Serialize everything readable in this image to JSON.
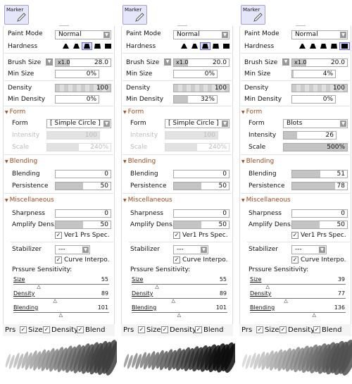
{
  "panels": [
    {
      "tool": "Marker",
      "paint_mode_label": "Paint Mode",
      "paint_mode": "Normal",
      "hardness_label": "Hardness",
      "hardness_selected": 2,
      "brush_size_label": "Brush Size",
      "brush_mult": "x1.0",
      "brush_size": "28.0",
      "min_size_label": "Min Size",
      "min_size": "0%",
      "min_size_fill": 0,
      "density_label": "Density",
      "density": "100",
      "min_density_label": "Min Density",
      "min_density": "0%",
      "min_density_fill": 0,
      "form_header": "Form",
      "form_label": "Form",
      "form": "[ Simple Circle ]",
      "form_enabled": false,
      "intensity_label": "Intensity",
      "intensity": "100",
      "intensity_fill": 1,
      "scale_label": "Scale",
      "scale": "240%",
      "scale_fill": 0.5,
      "blending_header": "Blending",
      "blending_label": "Blending",
      "blending": "0",
      "blending_fill": 0,
      "persistence_label": "Persistence",
      "persistence": "50",
      "persistence_fill": 0.5,
      "misc_header": "Miscellaneous",
      "sharpness_label": "Sharpness",
      "sharpness": "0",
      "sharpness_fill": 0,
      "amplify_label": "Amplify Dens.",
      "amplify": "50",
      "amplify_fill": 0.5,
      "ver1_label": "Ver1 Prs Spec.",
      "stabilizer_label": "Stabilizer",
      "stabilizer": "---",
      "curve_label": "Curve Interpo.",
      "pressure_label": "Prssure Sensitivity:",
      "pressure": [
        {
          "label": "Size",
          "value": "55"
        },
        {
          "label": "Density",
          "value": "89"
        },
        {
          "label": "Blending",
          "value": "101"
        }
      ],
      "prs_label": "Prs",
      "prs_size": "Size",
      "prs_density": "Density",
      "prs_blend": "Blend"
    },
    {
      "tool": "Marker",
      "paint_mode_label": "Paint Mode",
      "paint_mode": "Normal",
      "hardness_label": "Hardness",
      "hardness_selected": 2,
      "brush_size_label": "Brush Size",
      "brush_mult": "x1.0",
      "brush_size": "20.0",
      "min_size_label": "Min Size",
      "min_size": "0%",
      "min_size_fill": 0,
      "density_label": "Density",
      "density": "100",
      "min_density_label": "Min Density",
      "min_density": "32%",
      "min_density_fill": 0.32,
      "form_header": "Form",
      "form_label": "Form",
      "form": "[ Simple Circle ]",
      "form_enabled": false,
      "intensity_label": "Intensity",
      "intensity": "100",
      "intensity_fill": 1,
      "scale_label": "Scale",
      "scale": "240%",
      "scale_fill": 0.5,
      "blending_header": "Blending",
      "blending_label": "Blending",
      "blending": "0",
      "blending_fill": 0,
      "persistence_label": "Persistence",
      "persistence": "50",
      "persistence_fill": 0.5,
      "misc_header": "Miscellaneous",
      "sharpness_label": "Sharpness",
      "sharpness": "0",
      "sharpness_fill": 0,
      "amplify_label": "Amplify Dens.",
      "amplify": "50",
      "amplify_fill": 0.5,
      "ver1_label": "Ver1 Prs Spec.",
      "stabilizer_label": "Stabilizer",
      "stabilizer": "---",
      "curve_label": "Curve Interpo.",
      "pressure_label": "Prssure Sensitivity:",
      "pressure": [
        {
          "label": "Size",
          "value": "55"
        },
        {
          "label": "Density",
          "value": "89"
        },
        {
          "label": "Blending",
          "value": "101"
        }
      ],
      "prs_label": "Prs",
      "prs_size": "Size",
      "prs_density": "Density",
      "prs_blend": "Blend"
    },
    {
      "tool": "Marker",
      "paint_mode_label": "Paint Mode",
      "paint_mode": "Normal",
      "hardness_label": "Hardness",
      "hardness_selected": 4,
      "brush_size_label": "Brush Size",
      "brush_mult": "x1.0",
      "brush_size": "20.0",
      "min_size_label": "Min Size",
      "min_size": "4%",
      "min_size_fill": 0.04,
      "density_label": "Density",
      "density": "100",
      "min_density_label": "Min Density",
      "min_density": "0%",
      "min_density_fill": 0,
      "form_header": "Form",
      "form_label": "Form",
      "form": "Blots",
      "form_enabled": true,
      "intensity_label": "Intensity",
      "intensity": "26",
      "intensity_fill": 0.26,
      "scale_label": "Scale",
      "scale": "500%",
      "scale_fill": 1,
      "blending_header": "Blending",
      "blending_label": "Blending",
      "blending": "51",
      "blending_fill": 0.51,
      "persistence_label": "Persistence",
      "persistence": "78",
      "persistence_fill": 0.78,
      "misc_header": "Miscellaneous",
      "sharpness_label": "Sharpness",
      "sharpness": "0",
      "sharpness_fill": 0,
      "amplify_label": "Amplify Dens.",
      "amplify": "50",
      "amplify_fill": 0.5,
      "ver1_label": "Ver1 Prs Spec.",
      "stabilizer_label": "Stabilizer",
      "stabilizer": "---",
      "curve_label": "Curve Interpo.",
      "pressure_label": "Prssure Sensitivity:",
      "pressure": [
        {
          "label": "Size",
          "value": "39"
        },
        {
          "label": "Density",
          "value": "77"
        },
        {
          "label": "Blending",
          "value": "136"
        }
      ],
      "prs_label": "Prs",
      "prs_size": "Size",
      "prs_density": "Density",
      "prs_blend": "Blend"
    }
  ],
  "colors": {
    "section_header": "#a04a1a",
    "selection": "#6666ff",
    "tool_button": "#e6e6fb"
  }
}
